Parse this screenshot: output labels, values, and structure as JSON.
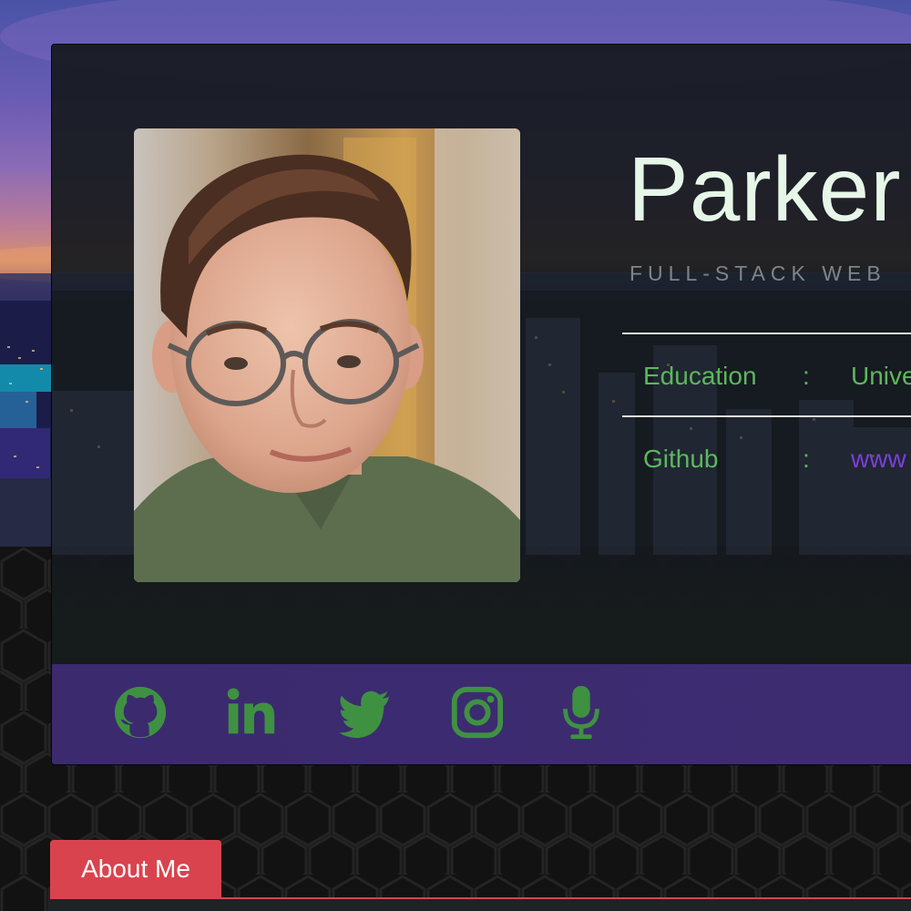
{
  "profile": {
    "name": "Parker",
    "subtitle": "FULL-STACK WEB",
    "photo_alt": "Portrait photo"
  },
  "info": [
    {
      "label": "Education",
      "separator": ":",
      "value": "Unive"
    },
    {
      "label": "Github",
      "separator": ":",
      "value": "www"
    }
  ],
  "social": [
    {
      "name": "github-icon"
    },
    {
      "name": "linkedin-icon"
    },
    {
      "name": "twitter-icon"
    },
    {
      "name": "instagram-icon"
    },
    {
      "name": "microphone-icon"
    }
  ],
  "tabs": {
    "about_label": "About Me"
  },
  "colors": {
    "accent_green": "#5cb85c",
    "link_purple": "#7b3fd9",
    "social_bar": "#3b2a6e",
    "tab_red": "#d9434d",
    "name_color": "#e6f7e8"
  }
}
